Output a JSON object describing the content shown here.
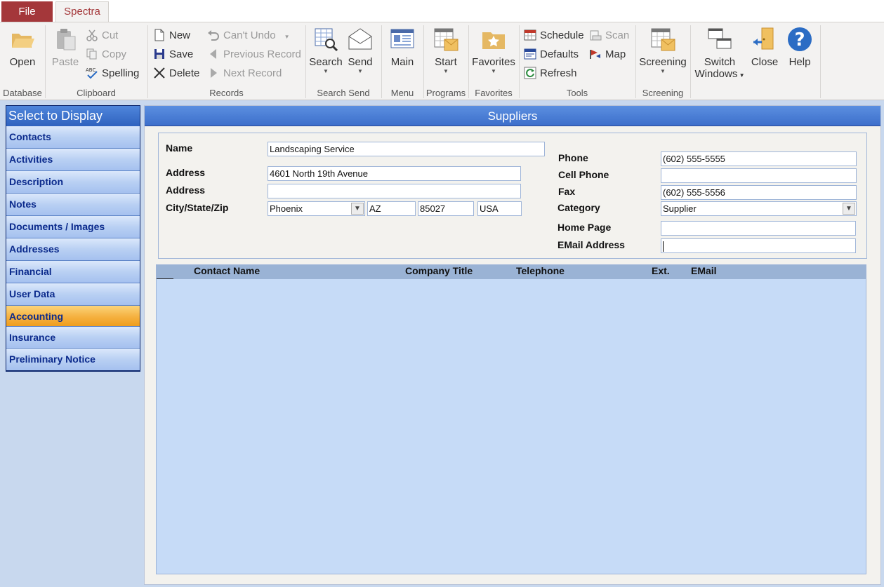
{
  "tabs": {
    "file": "File",
    "spectra": "Spectra"
  },
  "ribbon": {
    "database": {
      "label": "Database",
      "open": "Open"
    },
    "clipboard": {
      "label": "Clipboard",
      "paste": "Paste",
      "cut": "Cut",
      "copy": "Copy",
      "spelling": "Spelling",
      "spelling_badge": "ABC"
    },
    "records": {
      "label": "Records",
      "new": "New",
      "save": "Save",
      "delete": "Delete",
      "undo": "Can't Undo",
      "previous": "Previous Record",
      "next": "Next Record"
    },
    "search_send": {
      "label": "Search Send",
      "search": "Search",
      "send": "Send"
    },
    "menu": {
      "label": "Menu",
      "main": "Main"
    },
    "programs": {
      "label": "Programs",
      "start": "Start"
    },
    "favorites": {
      "label": "Favorites",
      "favorites": "Favorites"
    },
    "tools": {
      "label": "Tools",
      "schedule": "Schedule",
      "defaults": "Defaults",
      "refresh": "Refresh",
      "scan": "Scan",
      "map": "Map"
    },
    "screening": {
      "label": "Screening",
      "screening": "Screening"
    },
    "window": {
      "switch_line1": "Switch",
      "switch_line2": "Windows",
      "close": "Close",
      "help": "Help"
    }
  },
  "nav": {
    "header": "Select to Display",
    "items": [
      "Contacts",
      "Activities",
      "Description",
      "Notes",
      "Documents / Images",
      "Addresses",
      "Financial",
      "User Data",
      "Accounting",
      "Insurance",
      "Preliminary Notice"
    ],
    "active_item": "Accounting"
  },
  "form": {
    "title": "Suppliers",
    "labels": {
      "name": "Name",
      "address1": "Address",
      "address2": "Address",
      "city_state_zip": "City/State/Zip",
      "phone": "Phone",
      "cell_phone": "Cell Phone",
      "fax": "Fax",
      "category": "Category",
      "home_page": "Home Page",
      "email": "EMail Address"
    },
    "values": {
      "name": "Landscaping Service",
      "address1": "4601 North 19th Avenue",
      "address2": "",
      "city": "Phoenix",
      "state": "AZ",
      "zip": "85027",
      "country": "USA",
      "phone": "(602) 555-5555",
      "cell_phone": "",
      "fax": "(602) 555-5556",
      "category": "Supplier",
      "home_page": "",
      "email": ""
    }
  },
  "grid": {
    "columns": [
      "Contact Name",
      "Company Title",
      "Telephone",
      "Ext.",
      "EMail"
    ],
    "rows": []
  },
  "colors": {
    "file_tab": "#a4373a",
    "nav_active": "#f5b13f",
    "title_bar": "#3d6fcb",
    "grid_bg": "#c6dbf7"
  }
}
